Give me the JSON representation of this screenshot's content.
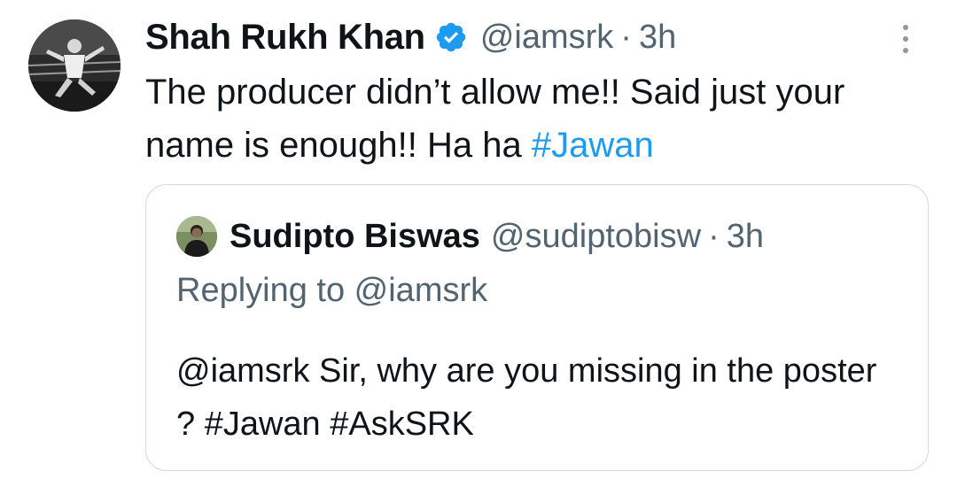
{
  "tweet": {
    "author_name": "Shah Rukh Khan",
    "handle": "@iamsrk",
    "separator": "·",
    "time": "3h",
    "verified_icon": "verified-badge-icon",
    "text_before_hashtag": "The producer didn’t allow me!! Said just your name is enough!! Ha ha ",
    "hashtag": "#Jawan",
    "more_icon": "more-options-icon"
  },
  "quoted_tweet": {
    "author_name": "Sudipto Biswas",
    "handle": "@sudiptobisw",
    "separator": "·",
    "time": "3h",
    "replying_to": "Replying to @iamsrk",
    "text": "@iamsrk Sir, why are you missing in the poster ? #Jawan #AskSRK"
  },
  "colors": {
    "text": "#0f1419",
    "secondary": "#536471",
    "link": "#1d9bf0",
    "border": "#cfd9de"
  }
}
